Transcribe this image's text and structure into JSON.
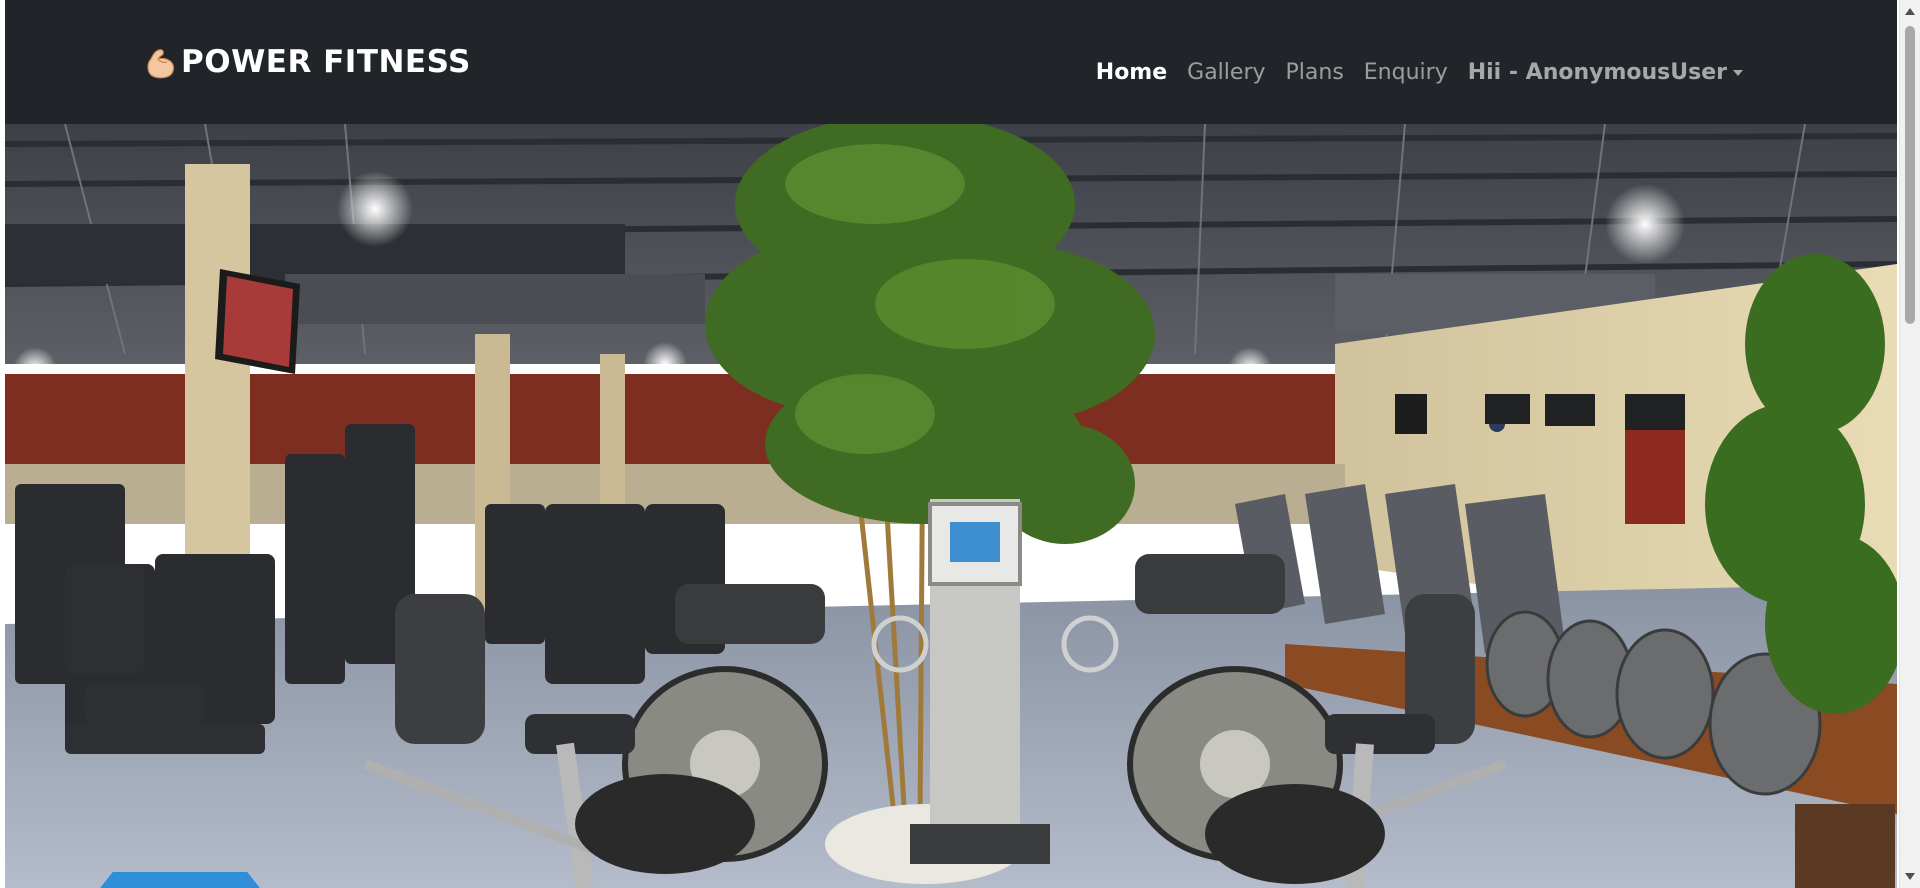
{
  "brand": {
    "icon": "flexed-biceps-icon",
    "name": "POWER FITNESS"
  },
  "nav": {
    "items": [
      {
        "label": "Home",
        "active": true
      },
      {
        "label": "Gallery",
        "active": false
      },
      {
        "label": "Plans",
        "active": false
      },
      {
        "label": "Enquiry",
        "active": false
      }
    ],
    "user_label": "Hii - AnonymousUser"
  },
  "hero": {
    "image_subject": "gym interior with exercise bikes, treadmills, weight machines and bamboo plant",
    "indicator_color": "#2f8fd8"
  },
  "colors": {
    "navbar_bg": "#212529",
    "nav_active": "#ffffff",
    "nav_inactive": "rgba(255,255,255,0.55)"
  }
}
